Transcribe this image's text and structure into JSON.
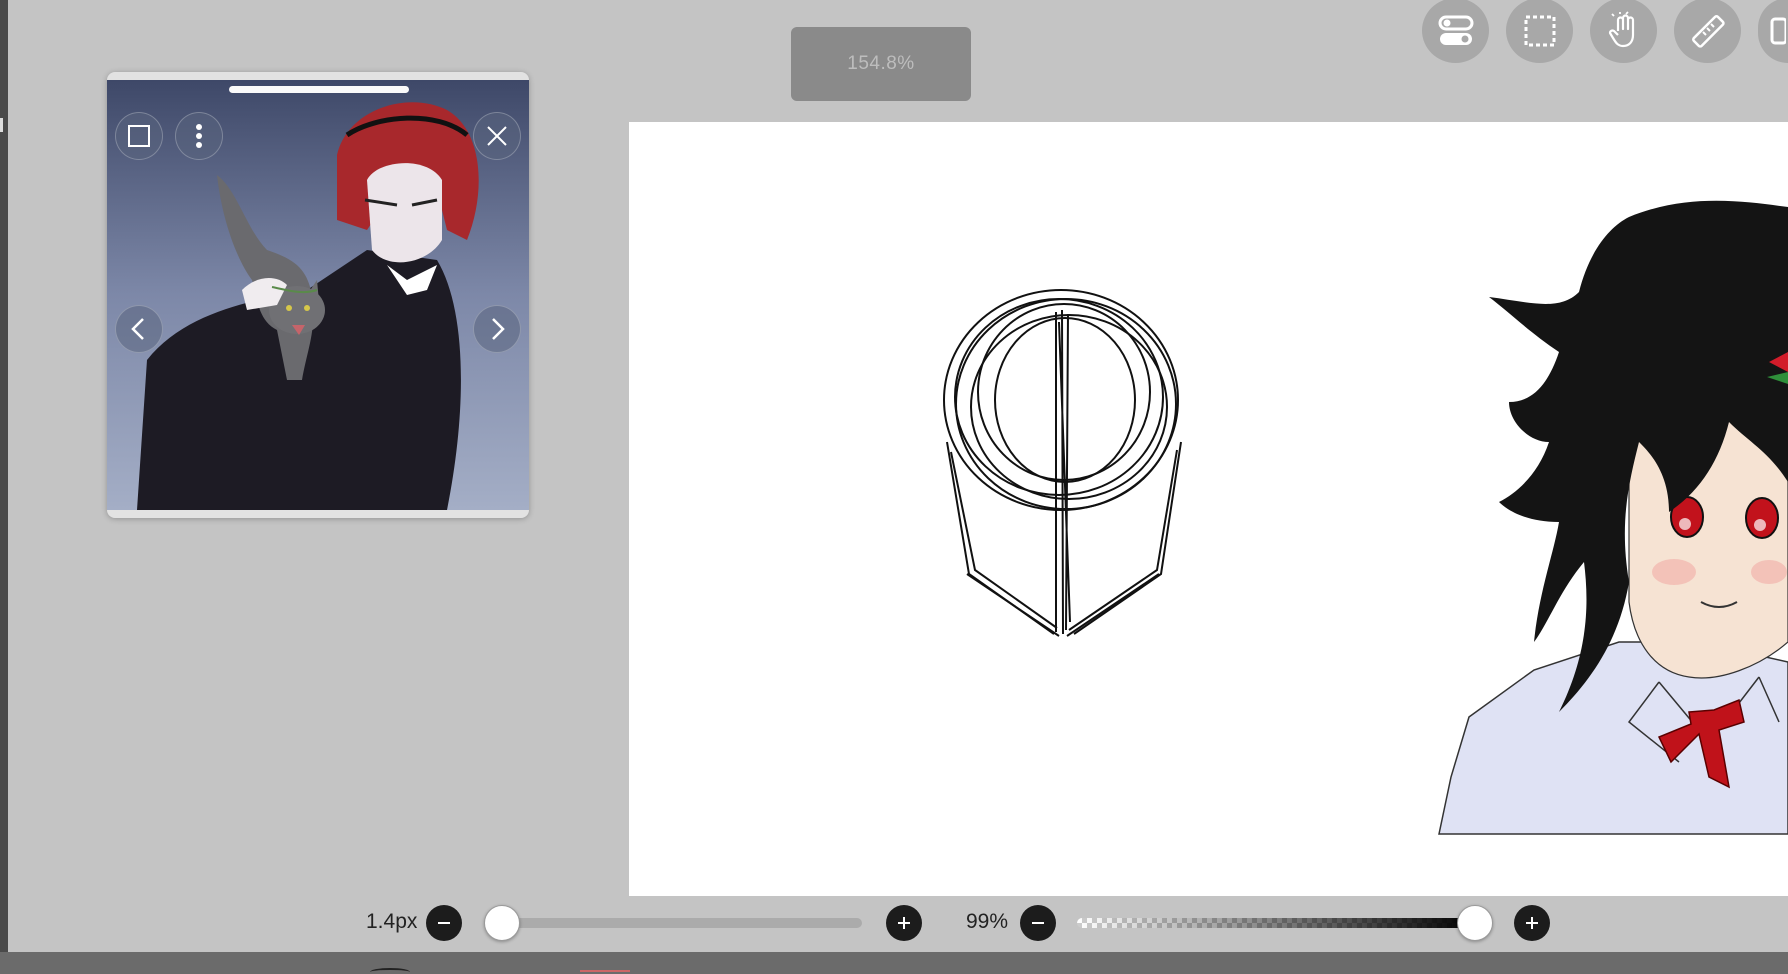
{
  "header": {
    "zoom_level": "154.8%"
  },
  "toolbar": {
    "items": [
      {
        "name": "toggle-icon"
      },
      {
        "name": "selection-icon"
      },
      {
        "name": "hand-icon"
      },
      {
        "name": "ruler-icon"
      },
      {
        "name": "layers-icon"
      }
    ]
  },
  "reference_window": {
    "buttons": [
      "frame-icon",
      "more-vertical-icon",
      "close-icon",
      "chevron-left-icon",
      "chevron-right-icon"
    ]
  },
  "brush": {
    "size_label": "1.4px",
    "size_level": 0.0
  },
  "opacity": {
    "label": "99%",
    "level": 0.99
  },
  "colors": {
    "background": "#c4c4c4",
    "canvas": "#ffffff",
    "button_dark": "#1c1c1c",
    "toolbar_button": "#a8a8a8"
  }
}
